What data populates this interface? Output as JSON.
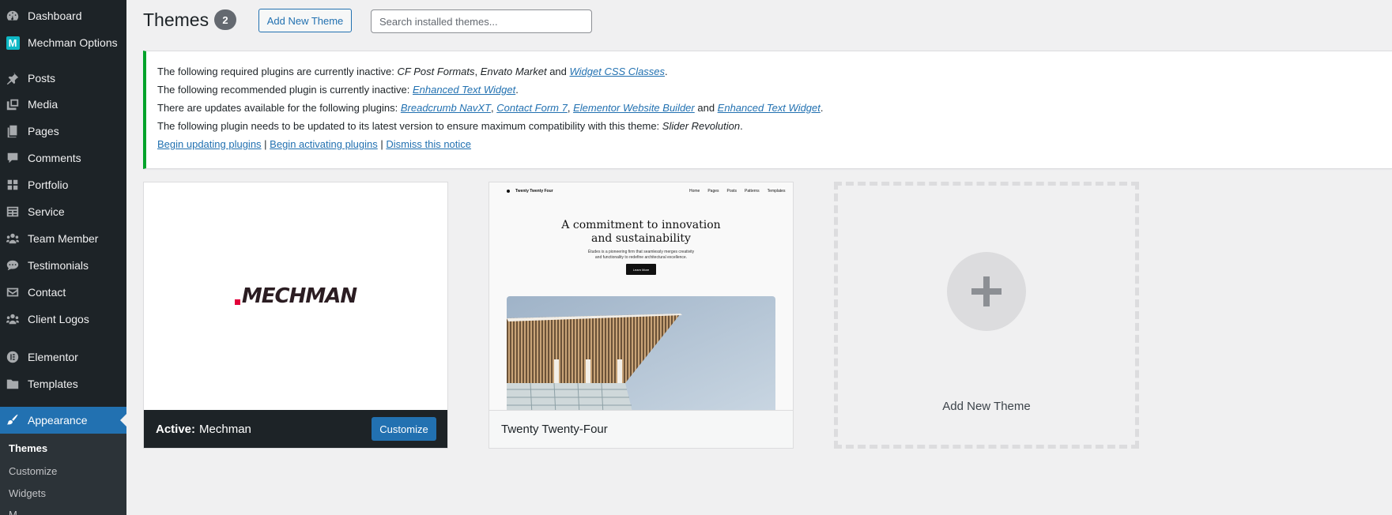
{
  "sidebar": {
    "items": [
      {
        "label": "Dashboard",
        "icon": "dashboard-icon"
      },
      {
        "label": "Mechman Options",
        "icon": "mechman-logo-icon",
        "logo_letter": "M"
      },
      {
        "label": "Posts",
        "icon": "pin-icon"
      },
      {
        "label": "Media",
        "icon": "media-icon"
      },
      {
        "label": "Pages",
        "icon": "pages-icon"
      },
      {
        "label": "Comments",
        "icon": "comments-icon"
      },
      {
        "label": "Portfolio",
        "icon": "portfolio-grid-icon"
      },
      {
        "label": "Service",
        "icon": "service-list-icon"
      },
      {
        "label": "Team Member",
        "icon": "groups-icon"
      },
      {
        "label": "Testimonials",
        "icon": "testimonial-bubble-icon"
      },
      {
        "label": "Contact",
        "icon": "email-icon"
      },
      {
        "label": "Client Logos",
        "icon": "groups-icon"
      },
      {
        "label": "Elementor",
        "icon": "elementor-icon"
      },
      {
        "label": "Templates",
        "icon": "folder-icon"
      },
      {
        "label": "Appearance",
        "icon": "paintbrush-icon",
        "current": true
      }
    ],
    "submenu": [
      {
        "label": "Themes",
        "current": true
      },
      {
        "label": "Customize"
      },
      {
        "label": "Widgets"
      },
      {
        "label": "M"
      }
    ]
  },
  "header": {
    "title": "Themes",
    "count": "2",
    "add_new_label": "Add New Theme",
    "search_placeholder": "Search installed themes..."
  },
  "notice": {
    "line1": {
      "text": "The following required plugins are currently inactive: ",
      "plugin_a": "CF Post Formats",
      "sep": ", ",
      "plugin_b": "Envato Market",
      "and": " and ",
      "link": "Widget CSS Classes",
      "end": "."
    },
    "line2": {
      "text": "The following recommended plugin is currently inactive: ",
      "link": "Enhanced Text Widget",
      "end": "."
    },
    "line3": {
      "text": "There are updates available for the following plugins: ",
      "link_a": "Breadcrumb NavXT",
      "sep1": ", ",
      "link_b": "Contact Form 7",
      "sep2": ", ",
      "link_c": "Elementor Website Builder",
      "and": " and ",
      "link_d": "Enhanced Text Widget",
      "end": "."
    },
    "line4": {
      "text": "The following plugin needs to be updated to its latest version to ensure maximum compatibility with this theme: ",
      "plugin": "Slider Revolution",
      "end": "."
    },
    "actions": {
      "begin_updating": "Begin updating plugins",
      "sep": " | ",
      "begin_activating": "Begin activating plugins",
      "dismiss": "Dismiss this notice"
    }
  },
  "themes": {
    "active": {
      "active_label": "Active:",
      "name": "Mechman",
      "logo_text": "MECHMAN",
      "customize_label": "Customize"
    },
    "second": {
      "name": "Twenty Twenty-Four",
      "preview": {
        "site_name": "Twenty Twenty Four",
        "nav_links": [
          "Home",
          "Pages",
          "Posts",
          "Patterns",
          "Templates"
        ],
        "headline_1": "A commitment to innovation",
        "headline_2": "and sustainability",
        "subtext_1": "Études is a pioneering firm that seamlessly merges creativity",
        "subtext_2": "and functionality to redefine architectural excellence.",
        "button": "Learn More"
      }
    },
    "add_new_label": "Add New Theme"
  },
  "colors": {
    "sidebar_bg": "#1d2327",
    "accent": "#2271b1",
    "notice_border": "#00a32a"
  }
}
